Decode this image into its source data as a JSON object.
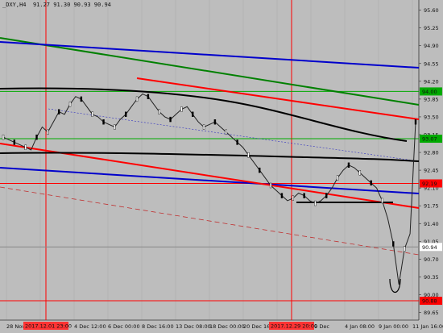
{
  "chart_header": {
    "symbol": "_DXY,H4",
    "ohlc": "91.27 91.30 90.93 90.94"
  },
  "chart_data": {
    "type": "line",
    "y_ticks": [
      "95.60",
      "95.25",
      "94.90",
      "94.55",
      "94.20",
      "93.85",
      "93.50",
      "93.15",
      "92.80",
      "92.45",
      "92.10",
      "91.75",
      "91.40",
      "91.05",
      "90.70",
      "90.35",
      "90.00",
      "89.65"
    ],
    "ylim": [
      89.5,
      95.8
    ],
    "x_ticks": [
      "28 Nov 2017",
      "30 Nov",
      "4 Dec 12:00",
      "6 Dec 00:00",
      "8 Dec 16:00",
      "13 Dec 08:00",
      "18 Dec 00:00",
      "20 Dec 16:00",
      "26 Dec 12:00",
      "29 Dec",
      "4 Jan 08:00",
      "9 Jan 00:00",
      "11 Jan 16:00"
    ],
    "vertical_marker_labels": [
      "2017.12.01 23:00",
      "2017.12.29 20:00"
    ],
    "horizontal_levels": [
      {
        "label": "94.00",
        "value": 94.0,
        "color": "#00aa00"
      },
      {
        "label": "93.07",
        "value": 93.07,
        "color": "#00aa00"
      },
      {
        "label": "92.19",
        "value": 92.19,
        "color": "#ff0000"
      },
      {
        "label": "90.94",
        "value": 90.94,
        "color": "#ffffff",
        "current_price": true
      },
      {
        "label": "90.88",
        "value": 89.88,
        "color": "#ff0000"
      }
    ],
    "price_series": {
      "name": "_DXY,H4",
      "close": [
        93.1,
        93.05,
        93.0,
        92.95,
        92.9,
        92.85,
        93.1,
        93.3,
        93.2,
        93.4,
        93.6,
        93.55,
        93.75,
        93.9,
        93.85,
        93.7,
        93.55,
        93.5,
        93.4,
        93.35,
        93.3,
        93.45,
        93.55,
        93.7,
        93.85,
        93.95,
        93.9,
        93.75,
        93.6,
        93.5,
        93.45,
        93.55,
        93.65,
        93.7,
        93.55,
        93.4,
        93.3,
        93.35,
        93.4,
        93.3,
        93.2,
        93.1,
        93.0,
        92.9,
        92.75,
        92.6,
        92.45,
        92.3,
        92.15,
        92.05,
        91.95,
        91.85,
        91.9,
        92.0,
        91.95,
        91.85,
        91.8,
        91.85,
        91.95,
        92.1,
        92.3,
        92.45,
        92.55,
        92.5,
        92.4,
        92.3,
        92.2,
        92.1,
        91.85,
        91.5,
        91.0,
        90.2,
        90.9,
        91.2,
        93.4
      ]
    },
    "moving_averages": [
      {
        "name": "MA long",
        "color": "#000000"
      },
      {
        "name": "MA short",
        "color": "#000000"
      }
    ],
    "trendlines": [
      {
        "name": "green channel upper",
        "color": "#008000"
      },
      {
        "name": "blue channel upper",
        "color": "#0000cc"
      },
      {
        "name": "blue channel lower",
        "color": "#0000cc"
      },
      {
        "name": "red channel upper",
        "color": "#ff0000"
      },
      {
        "name": "red channel lower",
        "color": "#ff0000"
      }
    ],
    "grid": true
  }
}
